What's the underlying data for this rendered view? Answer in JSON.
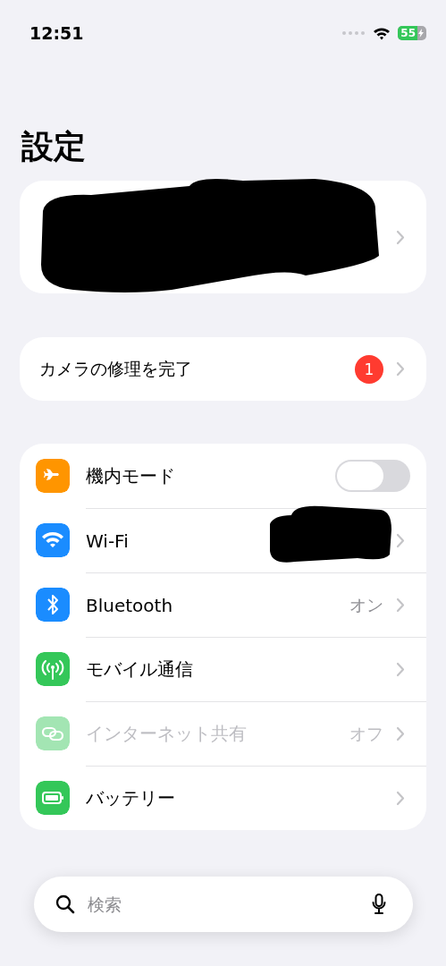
{
  "status_bar": {
    "time": "12:51",
    "battery": "55"
  },
  "title": "設定",
  "notice": {
    "label": "カメラの修理を完了",
    "badge": "1"
  },
  "settings": [
    {
      "kind": "toggle",
      "label": "機内モード",
      "on": false,
      "disabled": false
    },
    {
      "kind": "link",
      "label": "Wi-Fi",
      "redacted": true,
      "disabled": false
    },
    {
      "kind": "link",
      "label": "Bluetooth",
      "value": "オン",
      "disabled": false
    },
    {
      "kind": "link",
      "label": "モバイル通信",
      "disabled": false
    },
    {
      "kind": "link",
      "label": "インターネット共有",
      "value": "オフ",
      "disabled": true
    },
    {
      "kind": "link",
      "label": "バッテリー",
      "disabled": false
    }
  ],
  "search": {
    "placeholder": "検索"
  }
}
